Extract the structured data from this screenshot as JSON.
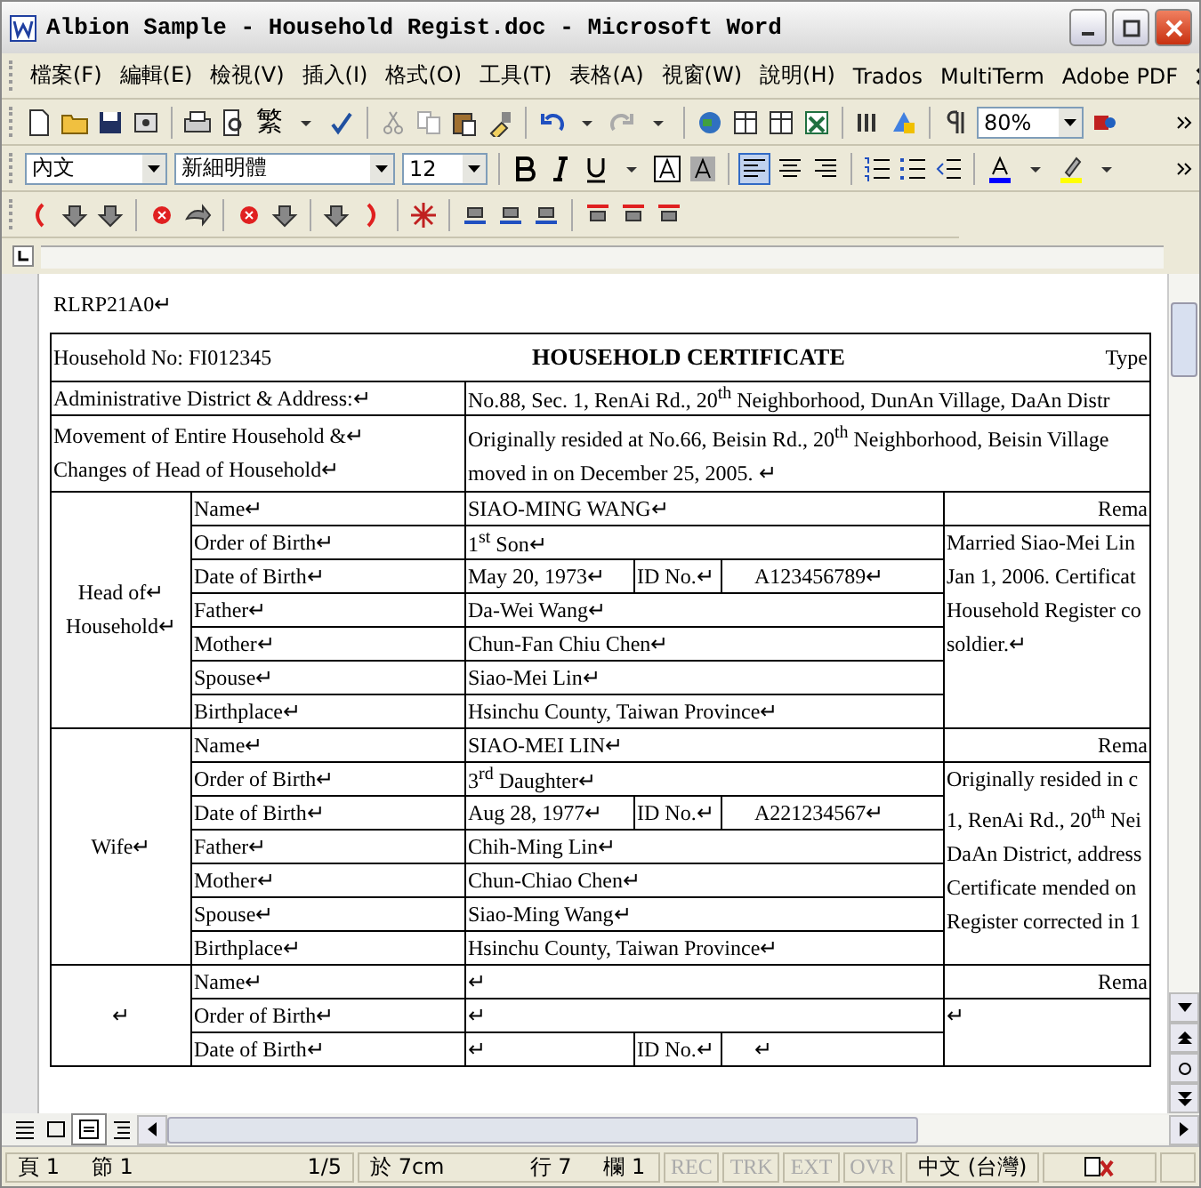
{
  "window": {
    "title": "Albion Sample - Household Regist.doc - Microsoft Word"
  },
  "menu": [
    {
      "label": "檔案(F)"
    },
    {
      "label": "編輯(E)"
    },
    {
      "label": "檢視(V)"
    },
    {
      "label": "插入(I)"
    },
    {
      "label": "格式(O)"
    },
    {
      "label": "工具(T)"
    },
    {
      "label": "表格(A)"
    },
    {
      "label": "視窗(W)"
    },
    {
      "label": "說明(H)"
    },
    {
      "label": "Trados"
    },
    {
      "label": "MultiTerm"
    },
    {
      "label": "Adobe PDF"
    }
  ],
  "standard_toolbar": {
    "convert_label": "繁",
    "zoom": "80%"
  },
  "formatting_toolbar": {
    "style": "內文",
    "font": "新細明體",
    "size": "12",
    "align_left_selected": true
  },
  "document": {
    "code": "RLRP21A0↵",
    "header": {
      "number": "Household No: FI012345",
      "title": "HOUSEHOLD CERTIFICATE",
      "type": "Type"
    },
    "address": {
      "label": "Administrative District & Address:↵",
      "value": "No.88, Sec. 1, RenAi Rd., 20$^{th}$ Neighborhood, DunAn Village, DaAn Distr"
    },
    "movement": {
      "label_lines": [
        "Movement of Entire Household &↵",
        "Changes of Head of Household↵"
      ],
      "value_lines": [
        "Originally resided at No.66, Beisin Rd., 20$^{th}$ Neighborhood, Beisin Village",
        "moved in on December 25, 2005. ↵"
      ]
    },
    "persons": [
      {
        "role_lines": [
          "Head of↵",
          "Household↵"
        ],
        "remarks_header": "Rema",
        "remarks": [
          "Married Siao-Mei Lin",
          "Jan 1, 2006. Certificat",
          "Household Register co",
          "soldier.↵"
        ],
        "fields": [
          {
            "label": "Name↵",
            "value": "SIAO-MING WANG↵"
          },
          {
            "label": "Order of Birth↵",
            "value": "1$^{st}$ Son↵"
          },
          {
            "label": "Date of Birth↵",
            "value": "May 20, 1973↵",
            "id_label": "ID No.↵",
            "id_value": "A123456789↵"
          },
          {
            "label": "Father↵",
            "value": "Da-Wei Wang↵"
          },
          {
            "label": "Mother↵",
            "value": "Chun-Fan Chiu Chen↵"
          },
          {
            "label": "Spouse↵",
            "value": "Siao-Mei Lin↵"
          },
          {
            "label": "Birthplace↵",
            "value": "Hsinchu County, Taiwan Province↵"
          }
        ]
      },
      {
        "role_lines": [
          "Wife↵"
        ],
        "remarks_header": "Rema",
        "remarks": [
          "Originally resided in c",
          "1, RenAi Rd., 20$^{th}$ Nei",
          "DaAn District, address",
          "Certificate mended on",
          "Register corrected in 1"
        ],
        "fields": [
          {
            "label": "Name↵",
            "value": "SIAO-MEI LIN↵"
          },
          {
            "label": "Order of Birth↵",
            "value": "3$^{rd}$ Daughter↵"
          },
          {
            "label": "Date of Birth↵",
            "value": "Aug 28, 1977↵",
            "id_label": "ID No.↵",
            "id_value": "A221234567↵"
          },
          {
            "label": "Father↵",
            "value": "Chih-Ming Lin↵"
          },
          {
            "label": "Mother↵",
            "value": "Chun-Chiao Chen↵"
          },
          {
            "label": "Spouse↵",
            "value": "Siao-Ming Wang↵"
          },
          {
            "label": "Birthplace↵",
            "value": "Hsinchu County, Taiwan Province↵"
          }
        ]
      },
      {
        "role_lines": [
          "↵"
        ],
        "remarks_header": "Rema",
        "remarks": [
          "↵"
        ],
        "fields": [
          {
            "label": "Name↵",
            "value": "↵"
          },
          {
            "label": "Order of Birth↵",
            "value": "↵"
          },
          {
            "label": "Date of Birth↵",
            "value": "↵",
            "id_label": "ID No.↵",
            "id_value": "↵"
          }
        ]
      }
    ]
  },
  "status_bar": {
    "page": "頁 1",
    "section": "節 1",
    "pages": "1/5",
    "at": "於 7cm",
    "line": "行 7",
    "column": "欄 1",
    "modes": [
      {
        "label": "REC",
        "disabled": true
      },
      {
        "label": "TRK",
        "disabled": true
      },
      {
        "label": "EXT",
        "disabled": true
      },
      {
        "label": "OVR",
        "disabled": true
      }
    ],
    "language": "中文 (台灣)"
  }
}
